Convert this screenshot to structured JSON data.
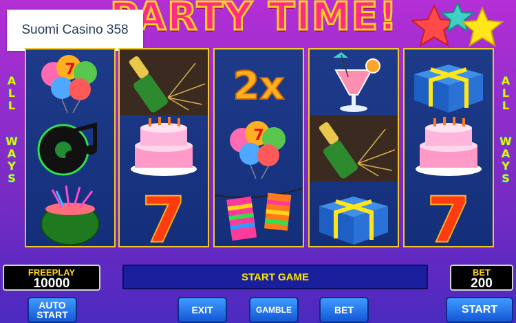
{
  "brand": {
    "name": "Suomi Casino 358"
  },
  "game": {
    "title": "PARTY TIME!"
  },
  "side_label": {
    "left": [
      "A",
      "L",
      "L",
      "W",
      "A",
      "Y",
      "S"
    ],
    "right": [
      "A",
      "L",
      "L",
      "W",
      "A",
      "Y",
      "S"
    ]
  },
  "reels": [
    [
      "balloons",
      "music-notes",
      "watermelon"
    ],
    [
      "champagne",
      "birthday-cake",
      "seven"
    ],
    [
      "multiplier-2x",
      "balloons",
      "party-lanterns"
    ],
    [
      "cocktail",
      "champagne",
      "gift-box"
    ],
    [
      "gift-box",
      "birthday-cake",
      "seven"
    ]
  ],
  "symbol_text": {
    "multiplier": "2x",
    "seven": "7"
  },
  "freeplay": {
    "label": "FREEPLAY",
    "value": "10000"
  },
  "bet_display": {
    "label": "BET",
    "value": "200"
  },
  "message": "START GAME",
  "buttons": {
    "auto_start": "AUTO\nSTART",
    "exit": "EXIT",
    "gamble": "GAMBLE",
    "bet": "BET",
    "start": "START"
  },
  "colors": {
    "frame_gold": "#f3c92a",
    "reel_bg": "#1e3b8a",
    "label_yellow": "#ffd21c",
    "button_blue": "#2a78f0"
  }
}
